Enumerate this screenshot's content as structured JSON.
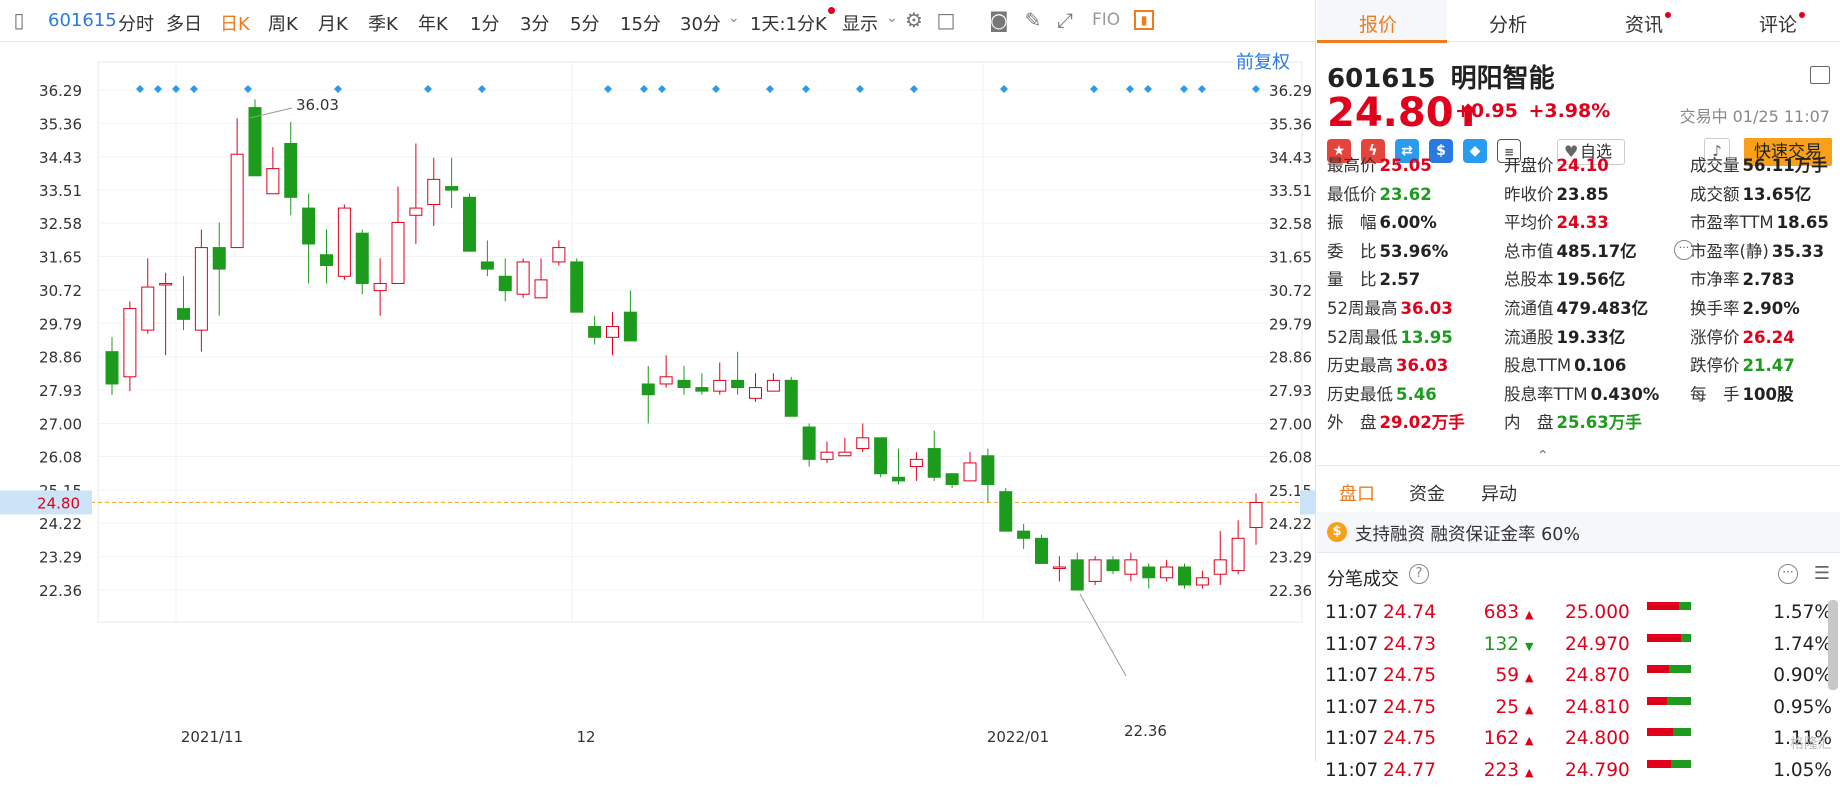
{
  "toolbar": {
    "code": "601615",
    "periods": [
      "分时",
      "多日",
      "日K",
      "周K",
      "月K",
      "季K",
      "年K",
      "1分",
      "3分",
      "5分",
      "15分",
      "30分"
    ],
    "active_period": "日K",
    "day_minute": "1天:1分K",
    "display": "显示",
    "fqtk": "FIO"
  },
  "chart": {
    "adjust_label": "前复权",
    "current_price_label": "24.80",
    "high_label": "36.03",
    "low_label": "22.36",
    "y_ticks": [
      "36.29",
      "35.36",
      "34.43",
      "33.51",
      "32.58",
      "31.65",
      "30.72",
      "29.79",
      "28.86",
      "27.93",
      "27.00",
      "26.08",
      "25.15",
      "24.22",
      "23.29",
      "22.36"
    ],
    "x_labels": [
      "2021/11",
      "12",
      "2022/01"
    ]
  },
  "chart_data": {
    "type": "candlestick",
    "ylim": [
      21.9,
      36.9
    ],
    "current": 24.8,
    "candles": [
      [
        29.0,
        28.1,
        29.4,
        27.8
      ],
      [
        28.3,
        30.2,
        30.4,
        27.9
      ],
      [
        29.6,
        30.8,
        31.6,
        29.5
      ],
      [
        30.9,
        30.9,
        31.2,
        28.9
      ],
      [
        30.2,
        29.9,
        31.1,
        29.6
      ],
      [
        29.6,
        31.9,
        32.4,
        29.0
      ],
      [
        31.9,
        31.3,
        32.6,
        30.0
      ],
      [
        31.9,
        34.5,
        35.5,
        31.9
      ],
      [
        35.8,
        33.9,
        36.03,
        33.9
      ],
      [
        33.4,
        34.1,
        34.7,
        33.4
      ],
      [
        34.8,
        33.3,
        35.4,
        32.8
      ],
      [
        33.0,
        32.0,
        33.4,
        30.9
      ],
      [
        31.7,
        31.4,
        32.4,
        30.9
      ],
      [
        31.1,
        33.0,
        33.1,
        31.0
      ],
      [
        32.3,
        30.9,
        32.4,
        30.6
      ],
      [
        30.7,
        30.9,
        31.6,
        30.0
      ],
      [
        30.9,
        32.6,
        33.6,
        30.9
      ],
      [
        32.8,
        33.0,
        34.8,
        32.0
      ],
      [
        33.1,
        33.8,
        34.4,
        32.5
      ],
      [
        33.6,
        33.5,
        34.4,
        33.0
      ],
      [
        33.3,
        31.8,
        33.4,
        31.8
      ],
      [
        31.5,
        31.3,
        32.1,
        31.1
      ],
      [
        31.1,
        30.7,
        31.6,
        30.4
      ],
      [
        30.6,
        31.5,
        31.6,
        30.5
      ],
      [
        30.5,
        31.0,
        31.6,
        30.5
      ],
      [
        31.5,
        31.9,
        32.1,
        31.4
      ],
      [
        31.5,
        30.1,
        31.6,
        30.1
      ],
      [
        29.7,
        29.4,
        30.0,
        29.2
      ],
      [
        29.4,
        29.7,
        30.1,
        28.9
      ],
      [
        30.1,
        29.3,
        30.7,
        29.3
      ],
      [
        28.1,
        27.8,
        28.6,
        27.0
      ],
      [
        28.1,
        28.3,
        28.9,
        28.0
      ],
      [
        28.2,
        28.0,
        28.6,
        27.8
      ],
      [
        28.0,
        27.9,
        28.4,
        27.8
      ],
      [
        27.9,
        28.2,
        28.7,
        27.8
      ],
      [
        28.2,
        28.0,
        29.0,
        27.8
      ],
      [
        27.7,
        28.0,
        28.4,
        27.6
      ],
      [
        27.9,
        28.2,
        28.4,
        27.9
      ],
      [
        28.2,
        27.2,
        28.3,
        27.2
      ],
      [
        26.9,
        26.0,
        27.0,
        25.8
      ],
      [
        26.0,
        26.2,
        26.5,
        25.9
      ],
      [
        26.1,
        26.2,
        26.6,
        26.1
      ],
      [
        26.3,
        26.6,
        27.0,
        26.2
      ],
      [
        26.6,
        25.6,
        26.6,
        25.5
      ],
      [
        25.5,
        25.4,
        26.3,
        25.3
      ],
      [
        25.8,
        26.0,
        26.2,
        25.4
      ],
      [
        26.3,
        25.5,
        26.8,
        25.4
      ],
      [
        25.6,
        25.3,
        25.6,
        25.2
      ],
      [
        25.4,
        25.9,
        26.2,
        25.4
      ],
      [
        26.1,
        25.3,
        26.3,
        24.8
      ],
      [
        25.1,
        24.0,
        25.2,
        24.0
      ],
      [
        24.0,
        23.8,
        24.2,
        23.5
      ],
      [
        23.8,
        23.1,
        23.9,
        23.1
      ],
      [
        23.0,
        23.0,
        23.3,
        22.6
      ],
      [
        23.2,
        22.36,
        23.4,
        22.36
      ],
      [
        22.6,
        23.2,
        23.3,
        22.5
      ],
      [
        23.2,
        22.9,
        23.3,
        22.8
      ],
      [
        22.8,
        23.2,
        23.4,
        22.6
      ],
      [
        23.0,
        22.7,
        23.1,
        22.4
      ],
      [
        22.7,
        23.0,
        23.2,
        22.6
      ],
      [
        23.0,
        22.5,
        23.1,
        22.4
      ],
      [
        22.5,
        22.7,
        22.9,
        22.4
      ],
      [
        22.8,
        23.2,
        24.0,
        22.5
      ],
      [
        22.9,
        23.8,
        24.3,
        22.8
      ],
      [
        24.1,
        24.8,
        25.05,
        23.62
      ]
    ]
  },
  "quote": {
    "code": "601615",
    "name": "明阳智能",
    "price": "24.80",
    "arrow": "⬆",
    "change": "+0.95",
    "change_pct": "+3.98%",
    "status": "交易中 01/25 11:07",
    "fav_label": "自选",
    "fast_trade": "快速交易"
  },
  "stats": [
    [
      {
        "k": "最高价",
        "v": "25.05",
        "c": "red"
      },
      {
        "k": "开盘价",
        "v": "24.10",
        "c": "red"
      },
      {
        "k": "成交量",
        "v": "56.11万手",
        "c": "blk"
      }
    ],
    [
      {
        "k": "最低价",
        "v": "23.62",
        "c": "green"
      },
      {
        "k": "昨收价",
        "v": "23.85",
        "c": "blk"
      },
      {
        "k": "成交额",
        "v": "13.65亿",
        "c": "blk"
      }
    ],
    [
      {
        "k": "振　幅",
        "v": "6.00%",
        "c": "blk"
      },
      {
        "k": "平均价",
        "v": "24.33",
        "c": "red"
      },
      {
        "k": "市盈率TTM",
        "v": "18.65",
        "c": "blk"
      }
    ],
    [
      {
        "k": "委　比",
        "v": "53.96%",
        "c": "blk"
      },
      {
        "k": "总市值",
        "v": "485.17亿",
        "c": "blk"
      },
      {
        "k": "市盈率(静)",
        "v": "35.33",
        "c": "blk"
      }
    ],
    [
      {
        "k": "量　比",
        "v": "2.57",
        "c": "blk"
      },
      {
        "k": "总股本",
        "v": "19.56亿",
        "c": "blk"
      },
      {
        "k": "市净率",
        "v": "2.783",
        "c": "blk"
      }
    ],
    [
      {
        "k": "52周最高",
        "v": "36.03",
        "c": "red"
      },
      {
        "k": "流通值",
        "v": "479.483亿",
        "c": "blk"
      },
      {
        "k": "换手率",
        "v": "2.90%",
        "c": "blk"
      }
    ],
    [
      {
        "k": "52周最低",
        "v": "13.95",
        "c": "green"
      },
      {
        "k": "流通股",
        "v": "19.33亿",
        "c": "blk"
      },
      {
        "k": "涨停价",
        "v": "26.24",
        "c": "red"
      }
    ],
    [
      {
        "k": "历史最高",
        "v": "36.03",
        "c": "red"
      },
      {
        "k": "股息TTM",
        "v": "0.106",
        "c": "blk"
      },
      {
        "k": "跌停价",
        "v": "21.47",
        "c": "green"
      }
    ],
    [
      {
        "k": "历史最低",
        "v": "5.46",
        "c": "green"
      },
      {
        "k": "股息率TTM",
        "v": "0.430%",
        "c": "blk"
      },
      {
        "k": "每　手",
        "v": "100股",
        "c": "blk"
      }
    ],
    [
      {
        "k": "外　盘",
        "v": "29.02万手",
        "c": "red"
      },
      {
        "k": "内　盘",
        "v": "25.63万手",
        "c": "green"
      },
      {
        "k": "",
        "v": "",
        "c": "blk"
      }
    ]
  ],
  "right_tabs": [
    "报价",
    "分析",
    "资讯",
    "评论"
  ],
  "section_tabs": [
    "盘口",
    "资金",
    "异动"
  ],
  "margin_text": "支持融资 融资保证金率 60%",
  "ticks_title": "分笔成交",
  "ticks": [
    {
      "t": "11:07",
      "p": "24.74",
      "v": "683",
      "dir": "up",
      "bid": "25.000",
      "pct": "1.57%",
      "r": 0.72
    },
    {
      "t": "11:07",
      "p": "24.73",
      "v": "132",
      "dir": "down",
      "bid": "24.970",
      "pct": "1.74%",
      "r": 0.78
    },
    {
      "t": "11:07",
      "p": "24.75",
      "v": "59",
      "dir": "up",
      "bid": "24.870",
      "pct": "0.90%",
      "r": 0.5
    },
    {
      "t": "11:07",
      "p": "24.75",
      "v": "25",
      "dir": "up",
      "bid": "24.810",
      "pct": "0.95%",
      "r": 0.45
    },
    {
      "t": "11:07",
      "p": "24.75",
      "v": "162",
      "dir": "up",
      "bid": "24.800",
      "pct": "1.11%",
      "r": 0.6
    },
    {
      "t": "11:07",
      "p": "24.77",
      "v": "223",
      "dir": "up",
      "bid": "24.790",
      "pct": "1.05%",
      "r": 0.55
    }
  ],
  "watermark": "格隆汇"
}
